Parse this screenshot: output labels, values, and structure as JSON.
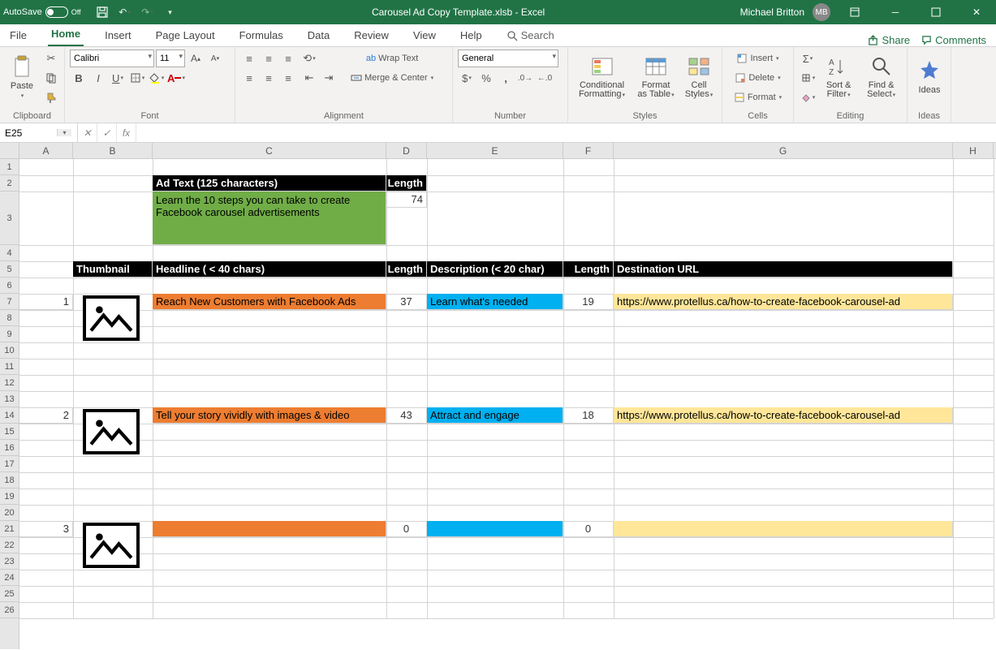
{
  "title": "Carousel Ad Copy Template.xlsb - Excel",
  "autosave_label": "AutoSave",
  "autosave_state": "Off",
  "user_name": "Michael Britton",
  "user_initials": "MB",
  "tabs": [
    "File",
    "Home",
    "Insert",
    "Page Layout",
    "Formulas",
    "Data",
    "Review",
    "View",
    "Help"
  ],
  "active_tab": "Home",
  "search_label": "Search",
  "share_label": "Share",
  "comments_label": "Comments",
  "ribbon": {
    "clipboard": {
      "label": "Clipboard",
      "paste": "Paste"
    },
    "font": {
      "label": "Font",
      "name": "Calibri",
      "size": "11"
    },
    "alignment": {
      "label": "Alignment",
      "wrap": "Wrap Text",
      "merge": "Merge & Center"
    },
    "number": {
      "label": "Number",
      "format": "General"
    },
    "styles": {
      "label": "Styles",
      "cond": "Conditional Formatting",
      "table": "Format as Table",
      "cellstyles": "Cell Styles"
    },
    "cells": {
      "label": "Cells",
      "insert": "Insert",
      "delete": "Delete",
      "format": "Format"
    },
    "editing": {
      "label": "Editing",
      "sort": "Sort & Filter",
      "find": "Find & Select"
    },
    "ideas": {
      "label": "Ideas",
      "btn": "Ideas"
    }
  },
  "name_box": "E25",
  "formula_value": "",
  "cols": {
    "A": 66,
    "B": 98,
    "C": 288,
    "D": 50,
    "E": 168,
    "F": 62,
    "G": 418,
    "H": 50
  },
  "row_heights": {
    "1": 20,
    "2": 20,
    "3": 66,
    "4": 20,
    "5": 20,
    "6": 20,
    "7": 20,
    "8": 20,
    "9": 20,
    "10": 20,
    "11": 20,
    "12": 20,
    "13": 20,
    "14": 20,
    "15": 20,
    "16": 20,
    "17": 20,
    "18": 20,
    "19": 20,
    "20": 20,
    "21": 20,
    "22": 20,
    "23": 20,
    "24": 20,
    "25": 20,
    "26": 20
  },
  "sheet": {
    "header_adtext": "Ad Text (125 characters)",
    "header_length_top": "Length",
    "ad_text": "Learn the 10 steps you can take to create Facebook carousel advertisements",
    "ad_text_len": "74",
    "hdr_thumb": "Thumbnail",
    "hdr_headline": "Headline ( < 40 chars)",
    "hdr_len": "Length",
    "hdr_desc": "Description (< 20 char)",
    "hdr_len2": "Length",
    "hdr_url": "Destination URL",
    "rows": [
      {
        "n": "1",
        "headline": "Reach New Customers with Facebook Ads",
        "hlen": "37",
        "desc": "Learn what's needed",
        "dlen": "19",
        "url": "https://www.protellus.ca/how-to-create-facebook-carousel-ad"
      },
      {
        "n": "2",
        "headline": "Tell your story vividly with images & video",
        "hlen": "43",
        "desc": "Attract and engage",
        "dlen": "18",
        "url": "https://www.protellus.ca/how-to-create-facebook-carousel-ad"
      },
      {
        "n": "3",
        "headline": "",
        "hlen": "0",
        "desc": "",
        "dlen": "0",
        "url": ""
      }
    ]
  }
}
